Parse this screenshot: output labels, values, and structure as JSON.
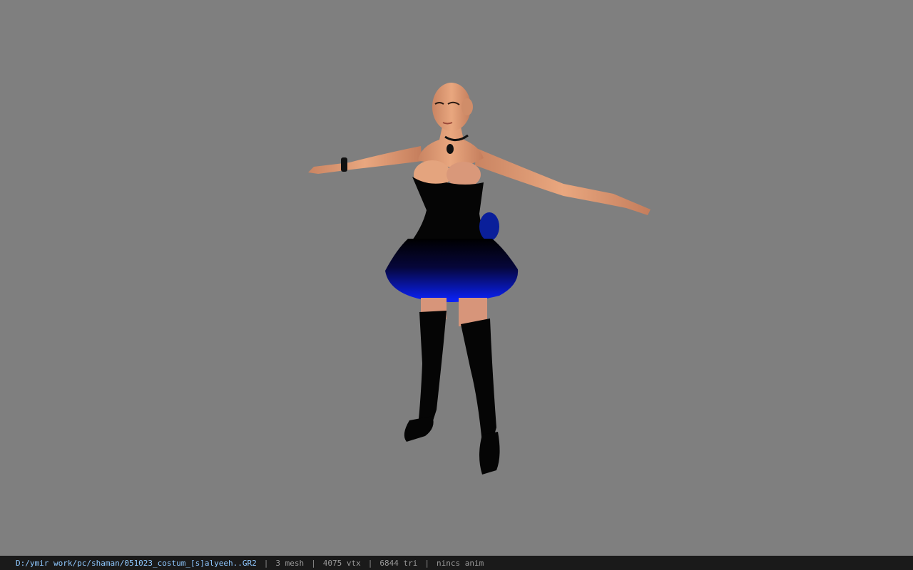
{
  "viewer": {
    "background_color": "#7f7f7f",
    "model_icon": "character-model",
    "status": {
      "file_path": "D:/ymir work/pc/shaman/051023_costum_[s]alyeeh..GR2",
      "separator": "|",
      "mesh": "3 mesh",
      "vertices": "4075 vtx",
      "triangles": "6844 tri",
      "anim": "nincs anim"
    }
  }
}
